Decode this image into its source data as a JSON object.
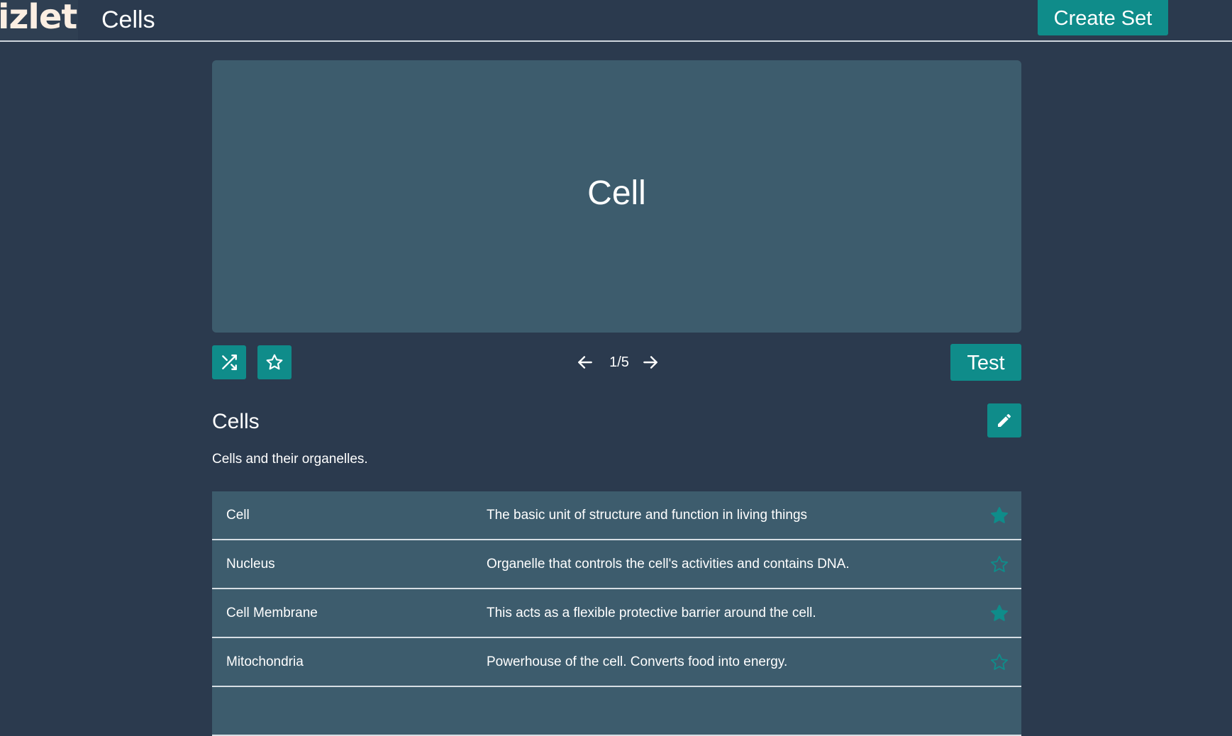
{
  "header": {
    "logo_text": "izlet",
    "title": "Cells",
    "create_button_label": "Create Set"
  },
  "flashcard": {
    "term": "Cell",
    "counter": "1/5"
  },
  "controls": {
    "test_label": "Test"
  },
  "set": {
    "title": "Cells",
    "description": "Cells and their organelles."
  },
  "terms": [
    {
      "term": "Cell",
      "definition": "The basic unit of structure and function in living things",
      "starred": true
    },
    {
      "term": "Nucleus",
      "definition": "Organelle that controls the cell's activities and contains DNA.",
      "starred": false
    },
    {
      "term": "Cell Membrane",
      "definition": "This acts as a flexible protective barrier around the cell.",
      "starred": true
    },
    {
      "term": "Mitochondria",
      "definition": "Powerhouse of the cell. Converts food into energy.",
      "starred": false
    }
  ],
  "colors": {
    "background": "#2b3a4e",
    "card": "#3d5c6d",
    "accent": "#0f8c8a"
  },
  "icons": {
    "shuffle": "shuffle-icon",
    "star": "star-icon",
    "prev": "arrow-left-icon",
    "next": "arrow-right-icon",
    "edit": "pencil-icon"
  }
}
